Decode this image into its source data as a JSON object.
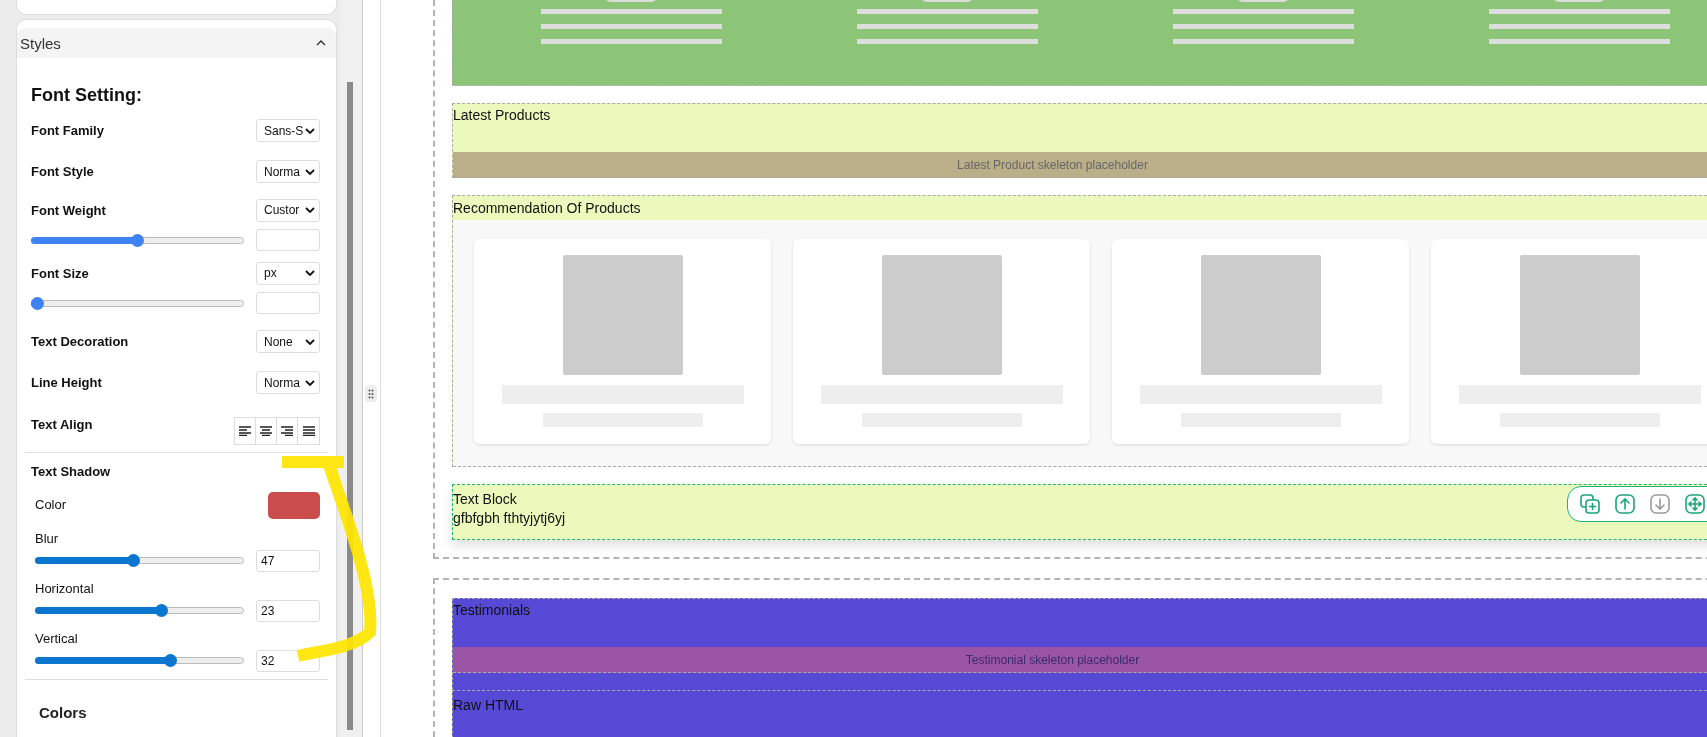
{
  "styles_panel": {
    "title": "Styles",
    "expanded": true,
    "font_setting": {
      "heading": "Font Setting:",
      "rows": [
        {
          "kind": "select",
          "label": "Font Family",
          "value": "Sans-S"
        },
        {
          "kind": "select",
          "label": "Font Style",
          "value": "Norma"
        },
        {
          "kind": "select_slider",
          "label": "Font Weight",
          "value": "Custor",
          "level": 0.5
        },
        {
          "kind": "select_slider",
          "label": "Font Size",
          "value": "px",
          "level": 0
        },
        {
          "kind": "select",
          "label": "Text Decoration",
          "value": "None"
        },
        {
          "kind": "select",
          "label": "Line Height",
          "value": "Norma"
        },
        {
          "kind": "align",
          "label": "Text Align",
          "options": [
            {
              "kind": "left"
            },
            {
              "kind": "center"
            },
            {
              "kind": "right"
            },
            {
              "kind": "justify"
            }
          ]
        }
      ]
    },
    "text_shadow": {
      "heading": "Text Shadow",
      "color_label": "Color",
      "color": "#cb4c4c",
      "sliders": [
        {
          "label": "Blur",
          "level": 0.47,
          "value": "47"
        },
        {
          "label": "Horizontal",
          "level": 0.61,
          "value": "23"
        },
        {
          "label": "Vertical",
          "level": 0.66,
          "value": "32"
        }
      ]
    },
    "colors_heading": "Colors"
  },
  "canvas": {
    "containers": [
      {
        "sections": [
          {
            "kind": "hero",
            "color": "#8dc578",
            "selected": false
          },
          {
            "kind": "skeleton_bar",
            "title": "Latest Products",
            "placeholder": "Latest Product skeleton placeholder",
            "color": "#ebfabc",
            "selected": false
          },
          {
            "kind": "cards",
            "title": "Recommendation Of Products",
            "color": "#ebfabc",
            "selected": false
          },
          {
            "kind": "text",
            "title": "Text Block",
            "body": "gfbfgbh fthtyjytj6yj",
            "color": "#ebfabc",
            "selected": true
          }
        ]
      },
      {
        "sections": [
          {
            "kind": "skeleton_bar",
            "title": "Testimonials",
            "placeholder": "Testimonial skeleton placeholder",
            "color": "#5549d5",
            "selected": false
          },
          {
            "kind": "text",
            "title": "Raw HTML",
            "color": "#5549d5",
            "selected": false
          }
        ]
      }
    ],
    "toolbar": [
      {
        "kind": "duplicate",
        "disabled": false
      },
      {
        "kind": "up",
        "disabled": false
      },
      {
        "kind": "down",
        "disabled": true
      },
      {
        "kind": "move",
        "disabled": false
      }
    ]
  }
}
